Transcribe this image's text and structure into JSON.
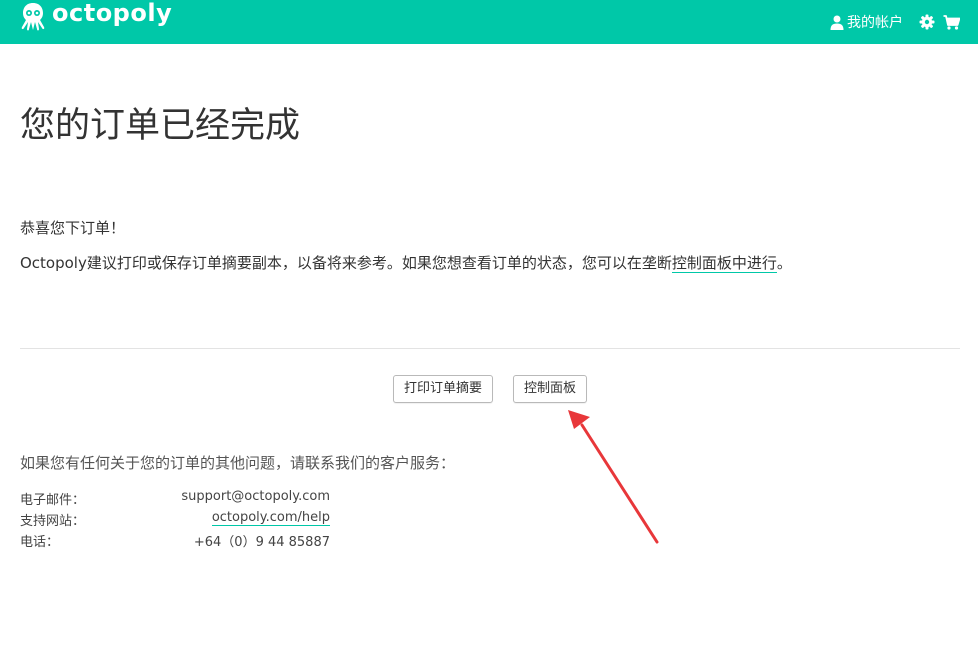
{
  "header": {
    "brand": "octopoly",
    "account_label": "我的帐户",
    "icons": [
      "octopus-logo-icon",
      "user-icon",
      "gear-icon",
      "cart-icon"
    ],
    "brand_color": "#00c8a8"
  },
  "main": {
    "title": "您的订单已经完成",
    "congrats": "恭喜您下订单！",
    "advice_prefix": "Octopoly建议打印或保存订单摘要副本，以备将来参考。如果您想查看订单的状态，您可以在垄断",
    "advice_link": "控制面板中进行",
    "advice_suffix": "。"
  },
  "actions": {
    "print_label": "打印订单摘要",
    "dashboard_label": "控制面板"
  },
  "contact": {
    "intro": "如果您有任何关于您的订单的其他问题，请联系我们的客户服务：",
    "rows": [
      {
        "label": "电子邮件：",
        "value": "support@octopoly.com"
      },
      {
        "label": "支持网站：",
        "value": "octopoly.com/help"
      },
      {
        "label": "电话：",
        "value": "+64（0）9 44 85887"
      }
    ]
  },
  "annotation": {
    "arrow_color": "#e8373a"
  }
}
